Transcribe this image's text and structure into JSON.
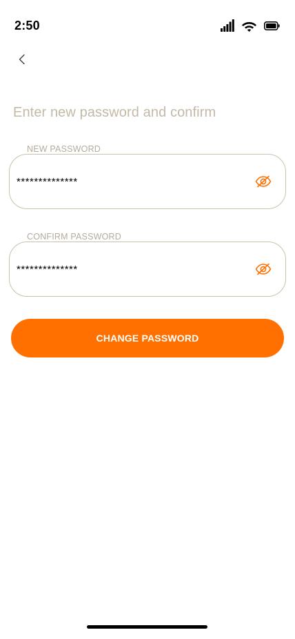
{
  "status_bar": {
    "time": "2:50"
  },
  "header": {
    "back_icon": "chevron-left-icon"
  },
  "instruction": "Enter new password and confirm",
  "fields": {
    "new_password": {
      "label": "NEW PASSWORD",
      "value": "**************",
      "toggle_icon": "eye-off-icon"
    },
    "confirm_password": {
      "label": "CONFIRM PASSWORD",
      "value": "**************",
      "toggle_icon": "eye-off-icon"
    }
  },
  "actions": {
    "change_password_label": "CHANGE PASSWORD"
  },
  "colors": {
    "accent": "#ff7000",
    "label": "#b5ab9b",
    "instruction": "#c3b9a6",
    "field_border": "#c9c1ad"
  }
}
